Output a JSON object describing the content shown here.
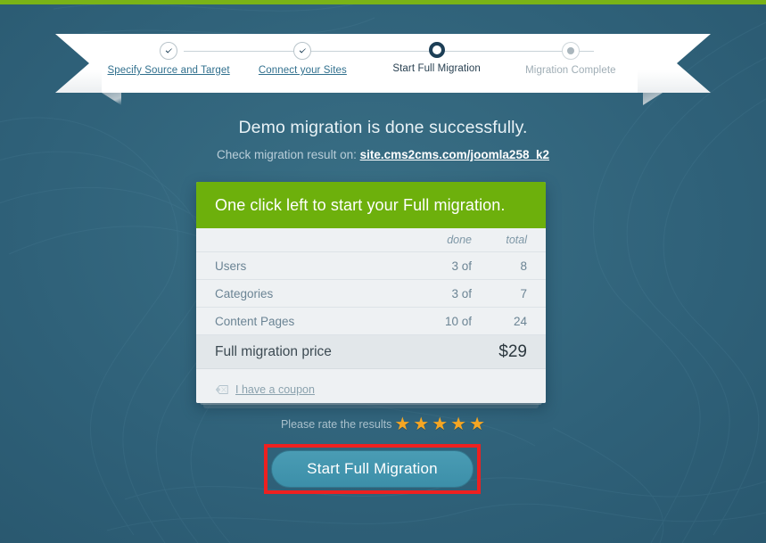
{
  "stepper": {
    "steps": [
      {
        "label": "Specify Source and Target",
        "state": "done"
      },
      {
        "label": "Connect your Sites",
        "state": "done"
      },
      {
        "label": "Start Full Migration",
        "state": "active"
      },
      {
        "label": "Migration Complete",
        "state": "todo"
      }
    ]
  },
  "headline": "Demo migration is done successfully.",
  "subline": {
    "prefix": "Check migration result on:",
    "link": "site.cms2cms.com/joomla258_k2"
  },
  "card": {
    "header": "One click left to start your Full migration.",
    "columns": {
      "name": "",
      "done": "done",
      "total": "total"
    },
    "rows": [
      {
        "name": "Users",
        "done": "3 of",
        "total": "8"
      },
      {
        "name": "Categories",
        "done": "3 of",
        "total": "7"
      },
      {
        "name": "Content Pages",
        "done": "10 of",
        "total": "24"
      }
    ],
    "price": {
      "label": "Full migration price",
      "value": "$29"
    },
    "coupon": {
      "icon": "coupon-ticket-icon",
      "label": "I have a coupon"
    }
  },
  "rating": {
    "label": "Please rate the results",
    "stars_filled": 5,
    "star_glyph": "★"
  },
  "cta": {
    "label": "Start Full Migration"
  },
  "colors": {
    "background": "#2f6179",
    "top_strip_green": "#7ab317",
    "card_header_green": "#6db00c",
    "cta_teal": "#3c8fa9",
    "highlight_red": "#ee2020",
    "star_gold": "#f5a623"
  }
}
